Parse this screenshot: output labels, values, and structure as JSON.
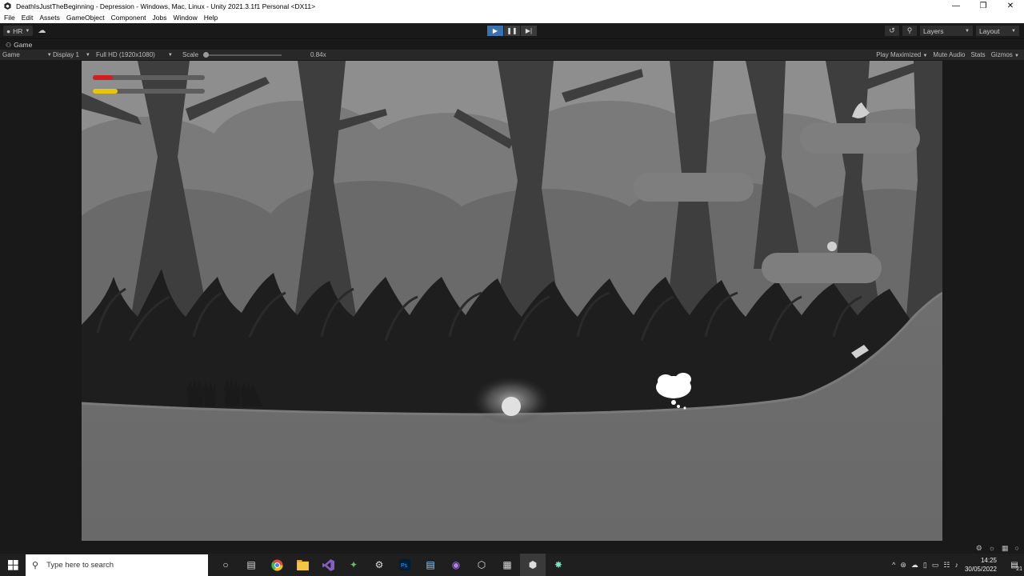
{
  "window": {
    "title": "DeathIsJustTheBeginning - Depression - Windows, Mac, Linux - Unity 2021.3.1f1 Personal <DX11>",
    "controls": [
      "minimize-icon",
      "restore-icon",
      "close-icon"
    ]
  },
  "menu": {
    "items": [
      "File",
      "Edit",
      "Assets",
      "GameObject",
      "Component",
      "Jobs",
      "Window",
      "Help"
    ]
  },
  "toolbar": {
    "account_label": "HR",
    "layers_label": "Layers",
    "layout_label": "Layout",
    "play_state": "playing"
  },
  "tab": {
    "label": "Game"
  },
  "gamebar": {
    "view_label": "Game",
    "display_label": "Display 1",
    "resolution_label": "Full HD (1920x1080)",
    "scale_label": "Scale",
    "scale_value": "0.84x",
    "play_maximized": "Play Maximized",
    "mute_audio": "Mute Audio",
    "stats": "Stats",
    "gizmos": "Gizmos"
  },
  "hud": {
    "health_fraction": 0.18,
    "stamina_fraction": 0.22,
    "health_color": "#d11f1f",
    "stamina_color": "#e8c60c"
  },
  "taskbar": {
    "search_placeholder": "Type here to search",
    "time": "14:25",
    "date": "30/05/2022",
    "notification_count": "21",
    "apps": [
      "task-view-icon",
      "chrome-icon",
      "file-explorer-icon",
      "visual-studio-icon",
      "sourcetree-icon",
      "settings-icon",
      "photoshop-icon",
      "notepad-icon",
      "github-desktop-icon",
      "unity-hub-icon",
      "calculator-icon",
      "unity-icon",
      "pinwheel-icon"
    ]
  }
}
